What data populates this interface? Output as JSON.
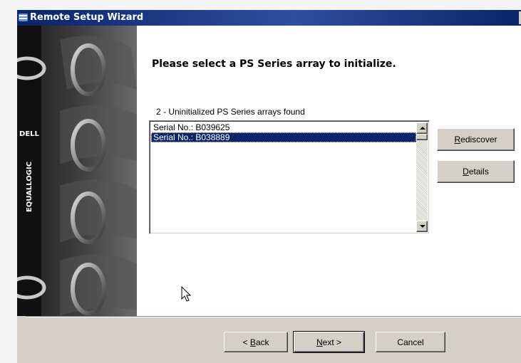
{
  "window": {
    "title": "Remote Setup Wizard"
  },
  "sidebar_image": {
    "brand_top": "DELL",
    "brand_side": "EQUALLOGIC"
  },
  "content": {
    "heading": "Please select a PS Series array to initialize.",
    "list_label": "2 - Uninitialized PS Series arrays found",
    "arrays": [
      {
        "label": "Serial No.: B039625",
        "selected": false
      },
      {
        "label": "Serial No.: B038889",
        "selected": true
      }
    ]
  },
  "buttons": {
    "rediscover": {
      "accel": "R",
      "rest": "ediscover"
    },
    "details": {
      "accel": "D",
      "rest": "etails"
    },
    "back": {
      "prefix": "< ",
      "accel": "B",
      "rest": "ack"
    },
    "next": {
      "accel": "N",
      "rest": "ext >"
    },
    "cancel": {
      "label": "Cancel"
    }
  },
  "colors": {
    "titlebar": "#0a246a",
    "selection": "#0a246a",
    "face": "#d4d0c8"
  }
}
